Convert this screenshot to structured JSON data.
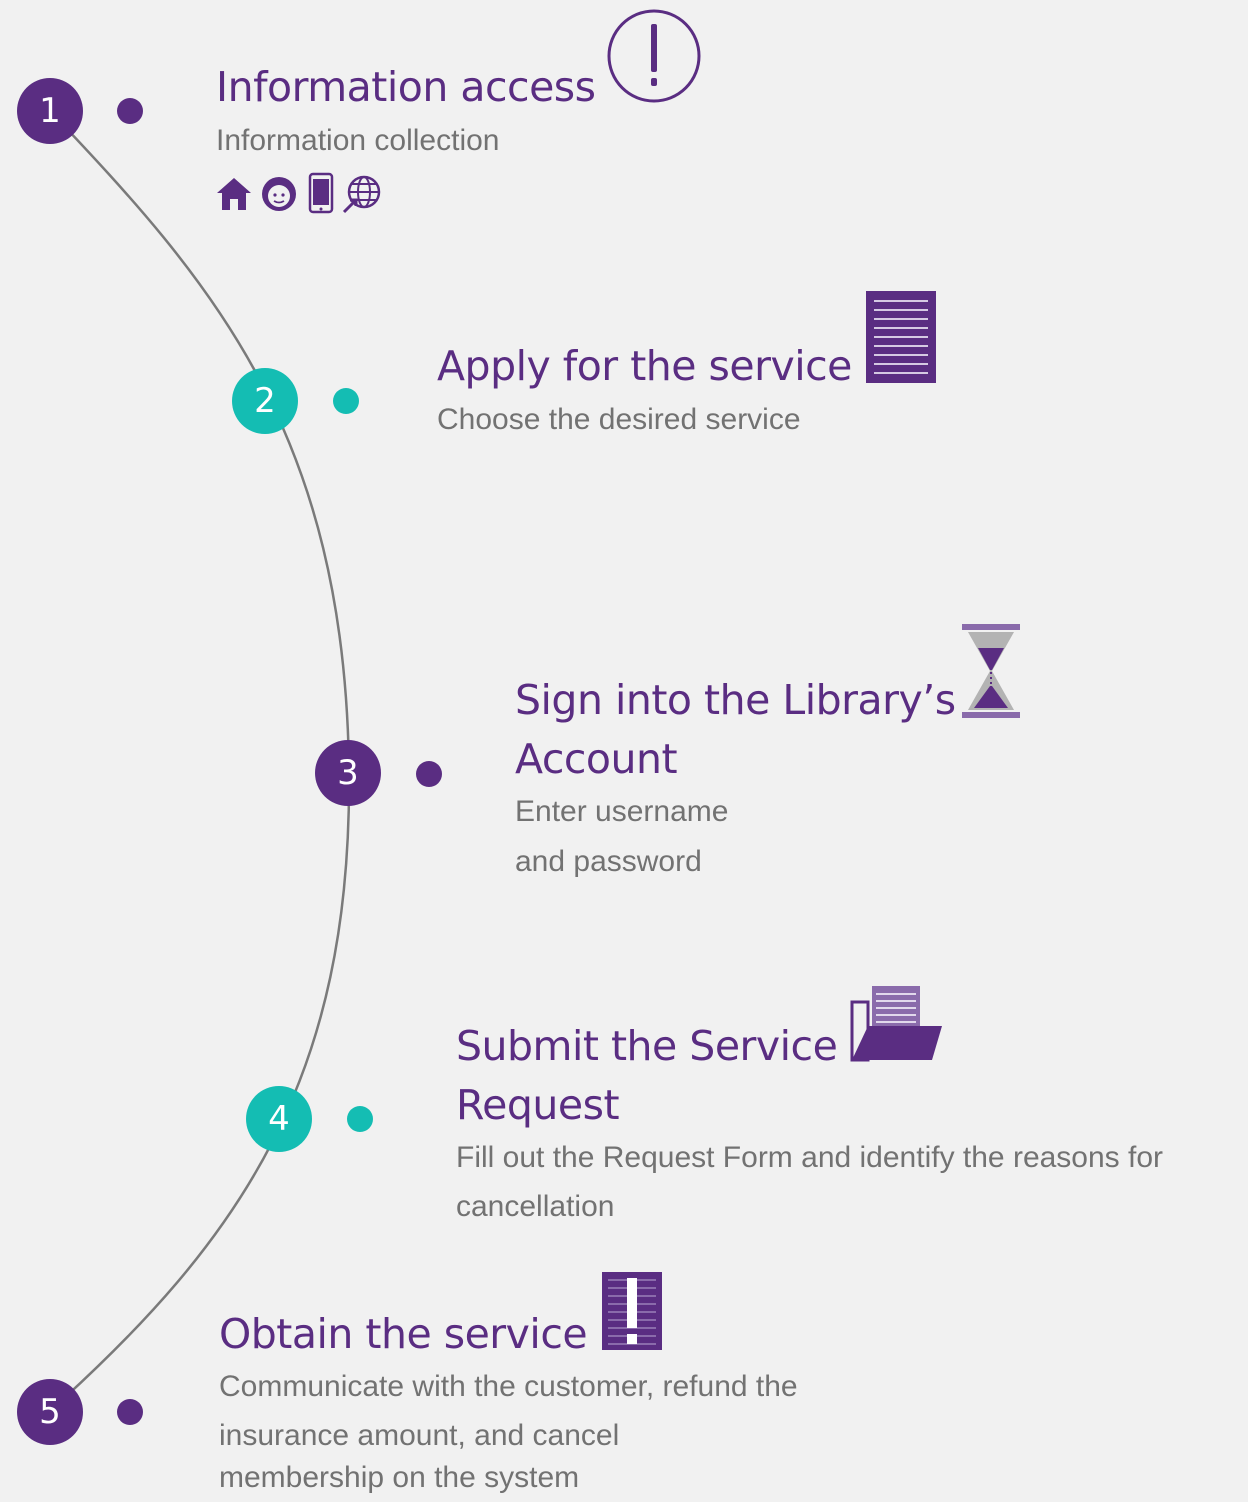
{
  "colors": {
    "purple": "#5a2d82",
    "teal": "#14bdb3",
    "text_gray": "#727272",
    "line_gray": "#7a7a7a",
    "background": "#f1f1f1"
  },
  "steps": [
    {
      "number": "1",
      "color": "purple",
      "title": "Information access",
      "description": [
        "Information collection"
      ],
      "icon": "exclamation-circle-icon",
      "channel_icons": [
        "home-icon",
        "call-center-agent-icon",
        "smartphone-icon",
        "globe-icon"
      ]
    },
    {
      "number": "2",
      "color": "teal",
      "title": "Apply for the service",
      "description": [
        "Choose the desired service"
      ],
      "icon": "document-lines-icon"
    },
    {
      "number": "3",
      "color": "purple",
      "title": [
        "Sign into the Library’s",
        "Account"
      ],
      "description": [
        "Enter username",
        "and password"
      ],
      "icon": "hourglass-icon"
    },
    {
      "number": "4",
      "color": "teal",
      "title": [
        "Submit the Service",
        "Request"
      ],
      "description": [
        "Fill out the Request Form and identify the reasons for",
        "cancellation"
      ],
      "icon": "open-folder-icon"
    },
    {
      "number": "5",
      "color": "purple",
      "title": "Obtain the service",
      "description": [
        "Communicate with the customer, refund the",
        "insurance amount, and cancel",
        "membership on the system"
      ],
      "icon": "document-exclamation-icon"
    }
  ]
}
